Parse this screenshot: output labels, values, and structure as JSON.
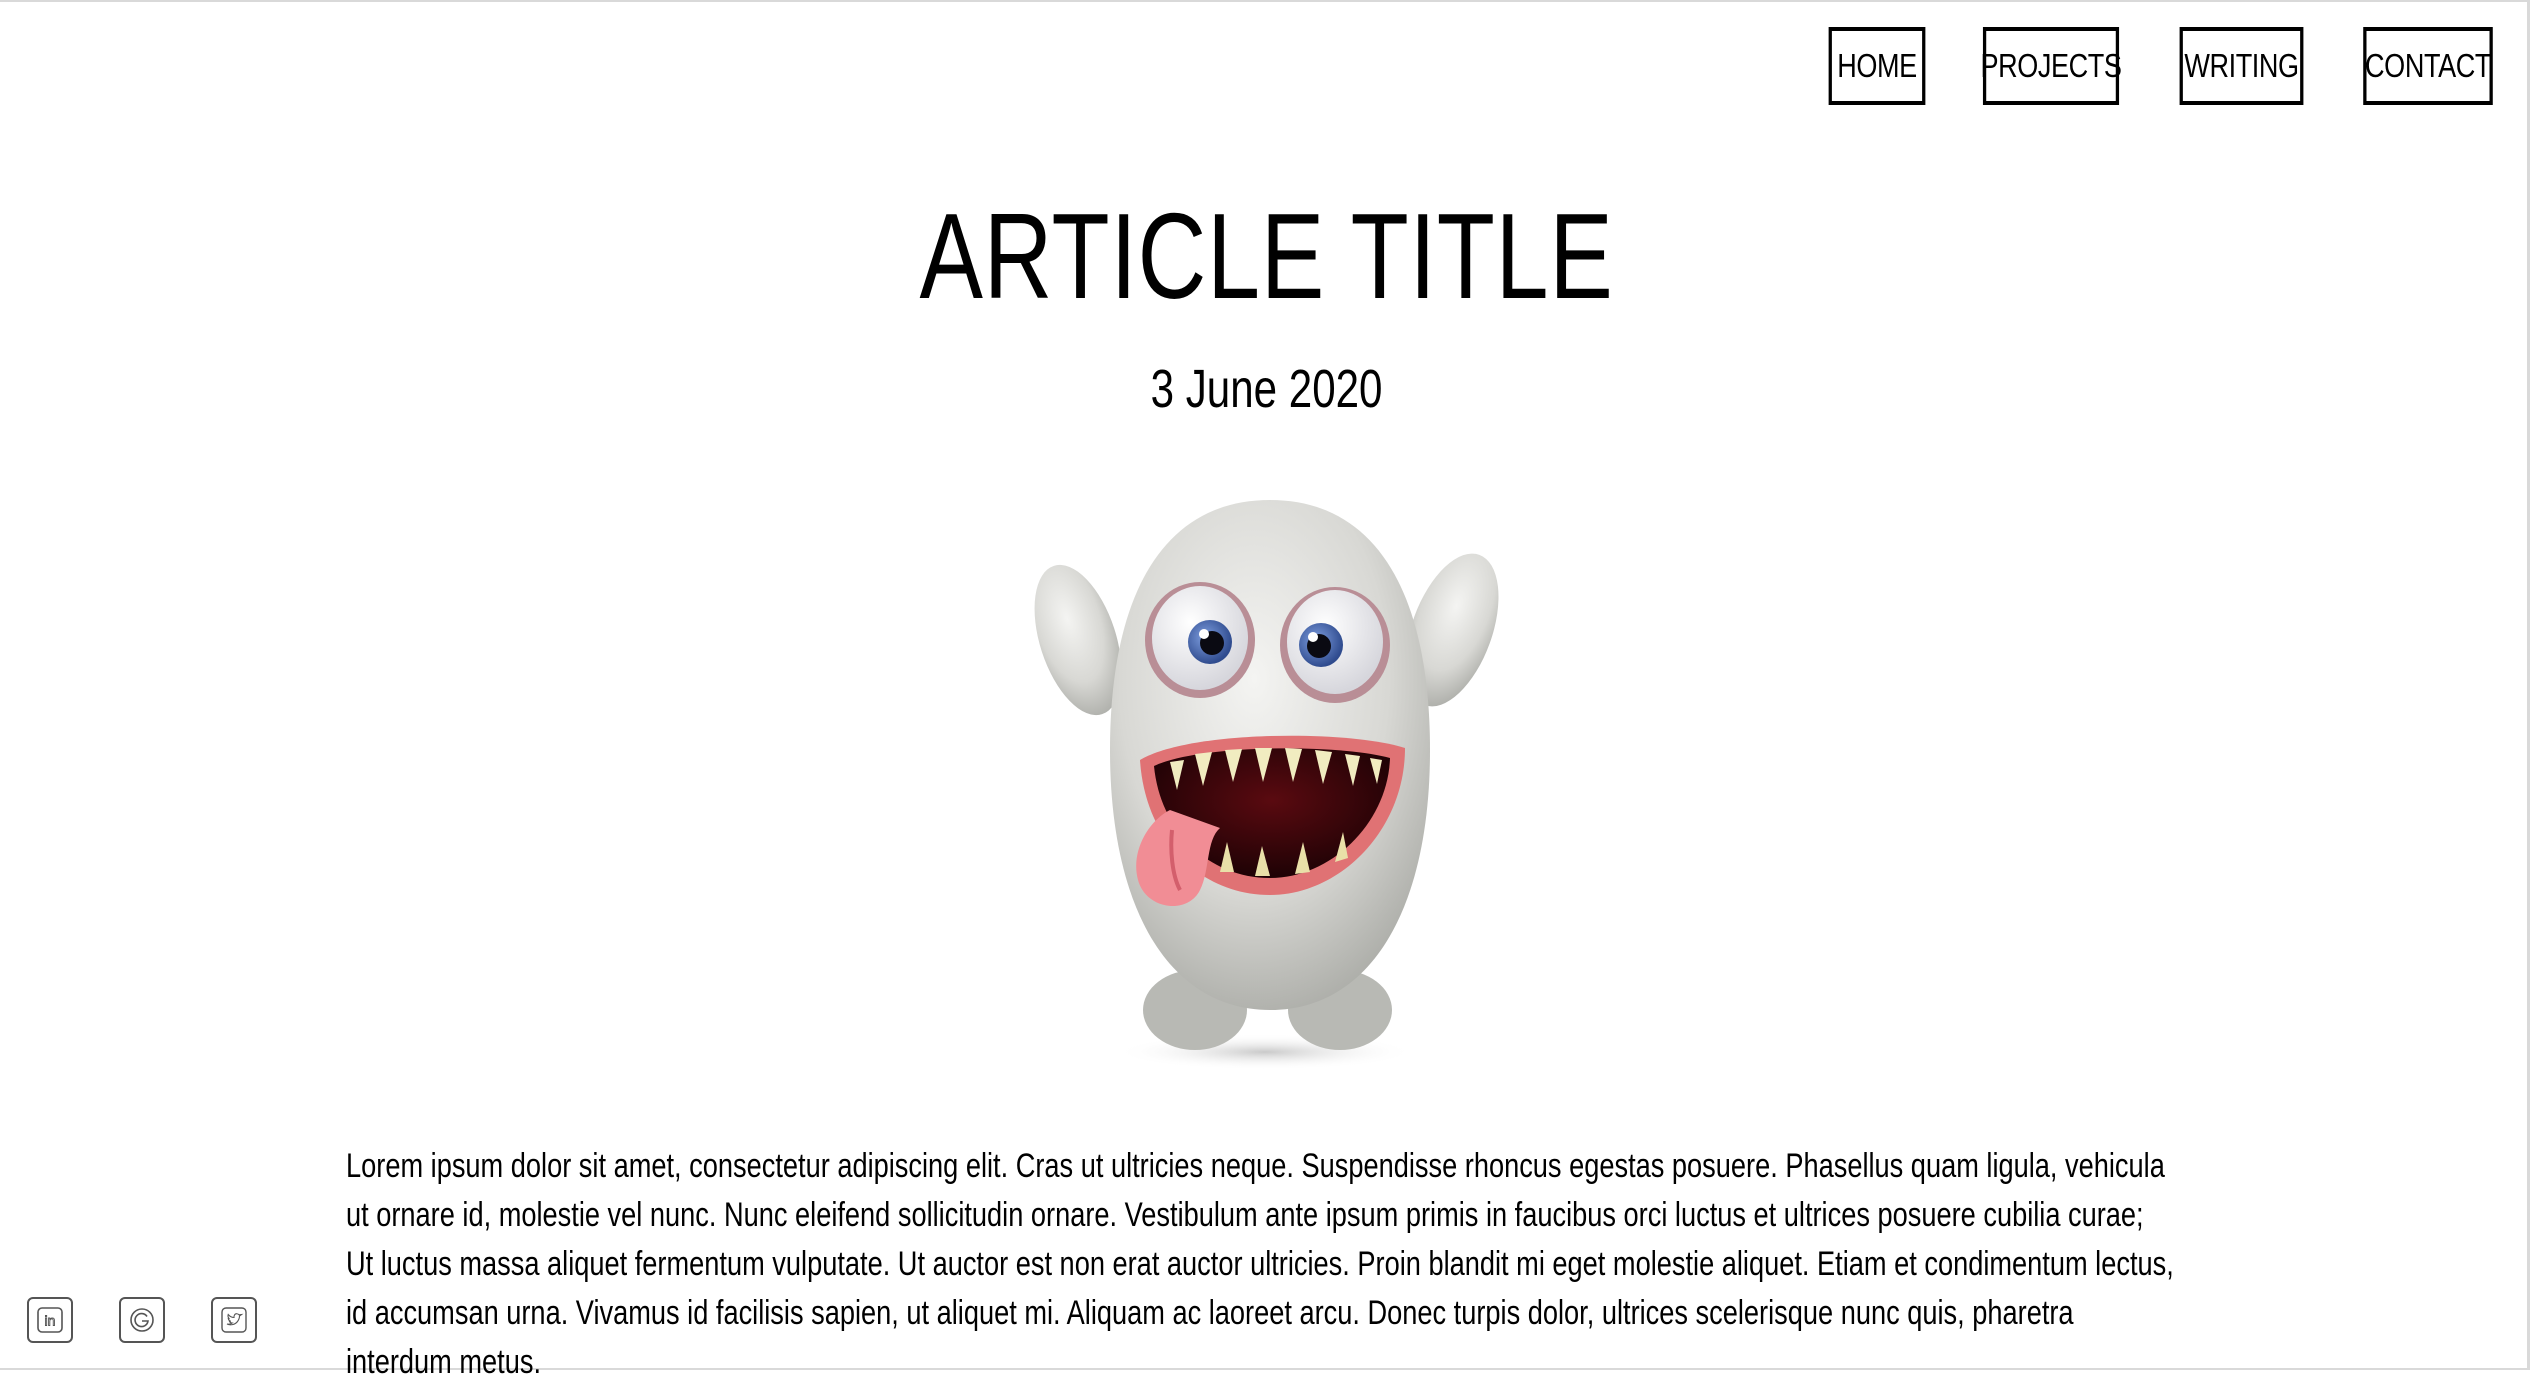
{
  "nav": {
    "items": [
      {
        "label": "HOME"
      },
      {
        "label": "PROJECTS"
      },
      {
        "label": "WRITING"
      },
      {
        "label": "CONTACT"
      }
    ]
  },
  "article": {
    "title": "ARTICLE TITLE",
    "date": "3 June 2020",
    "body": "Lorem ipsum dolor sit amet, consectetur adipiscing elit. Cras ut ultricies neque. Suspendisse rhoncus egestas posuere. Phasellus quam ligula, vehicula ut ornare id, molestie vel nunc. Nunc eleifend sollicitudin ornare. Vestibulum ante ipsum primis in faucibus orci luctus et ultrices posuere cubilia curae; Ut luctus massa aliquet fermentum vulputate. Ut auctor est non erat auctor ultricies. Proin blandit mi eget molestie aliquet. Etiam et condimentum lectus, id accumsan urna. Vivamus id facilisis sapien, ut aliquet mi. Aliquam ac laoreet arcu. Donec turpis dolor, ultrices scelerisque nunc quis, pharetra interdum metus.",
    "hero_image": "furry-monster-illustration"
  },
  "social": {
    "icons": [
      "linkedin-icon",
      "google-icon",
      "twitter-icon"
    ]
  },
  "colors": {
    "text": "#000000",
    "background": "#ffffff",
    "border": "#000000",
    "frame": "#d9d9d9"
  }
}
